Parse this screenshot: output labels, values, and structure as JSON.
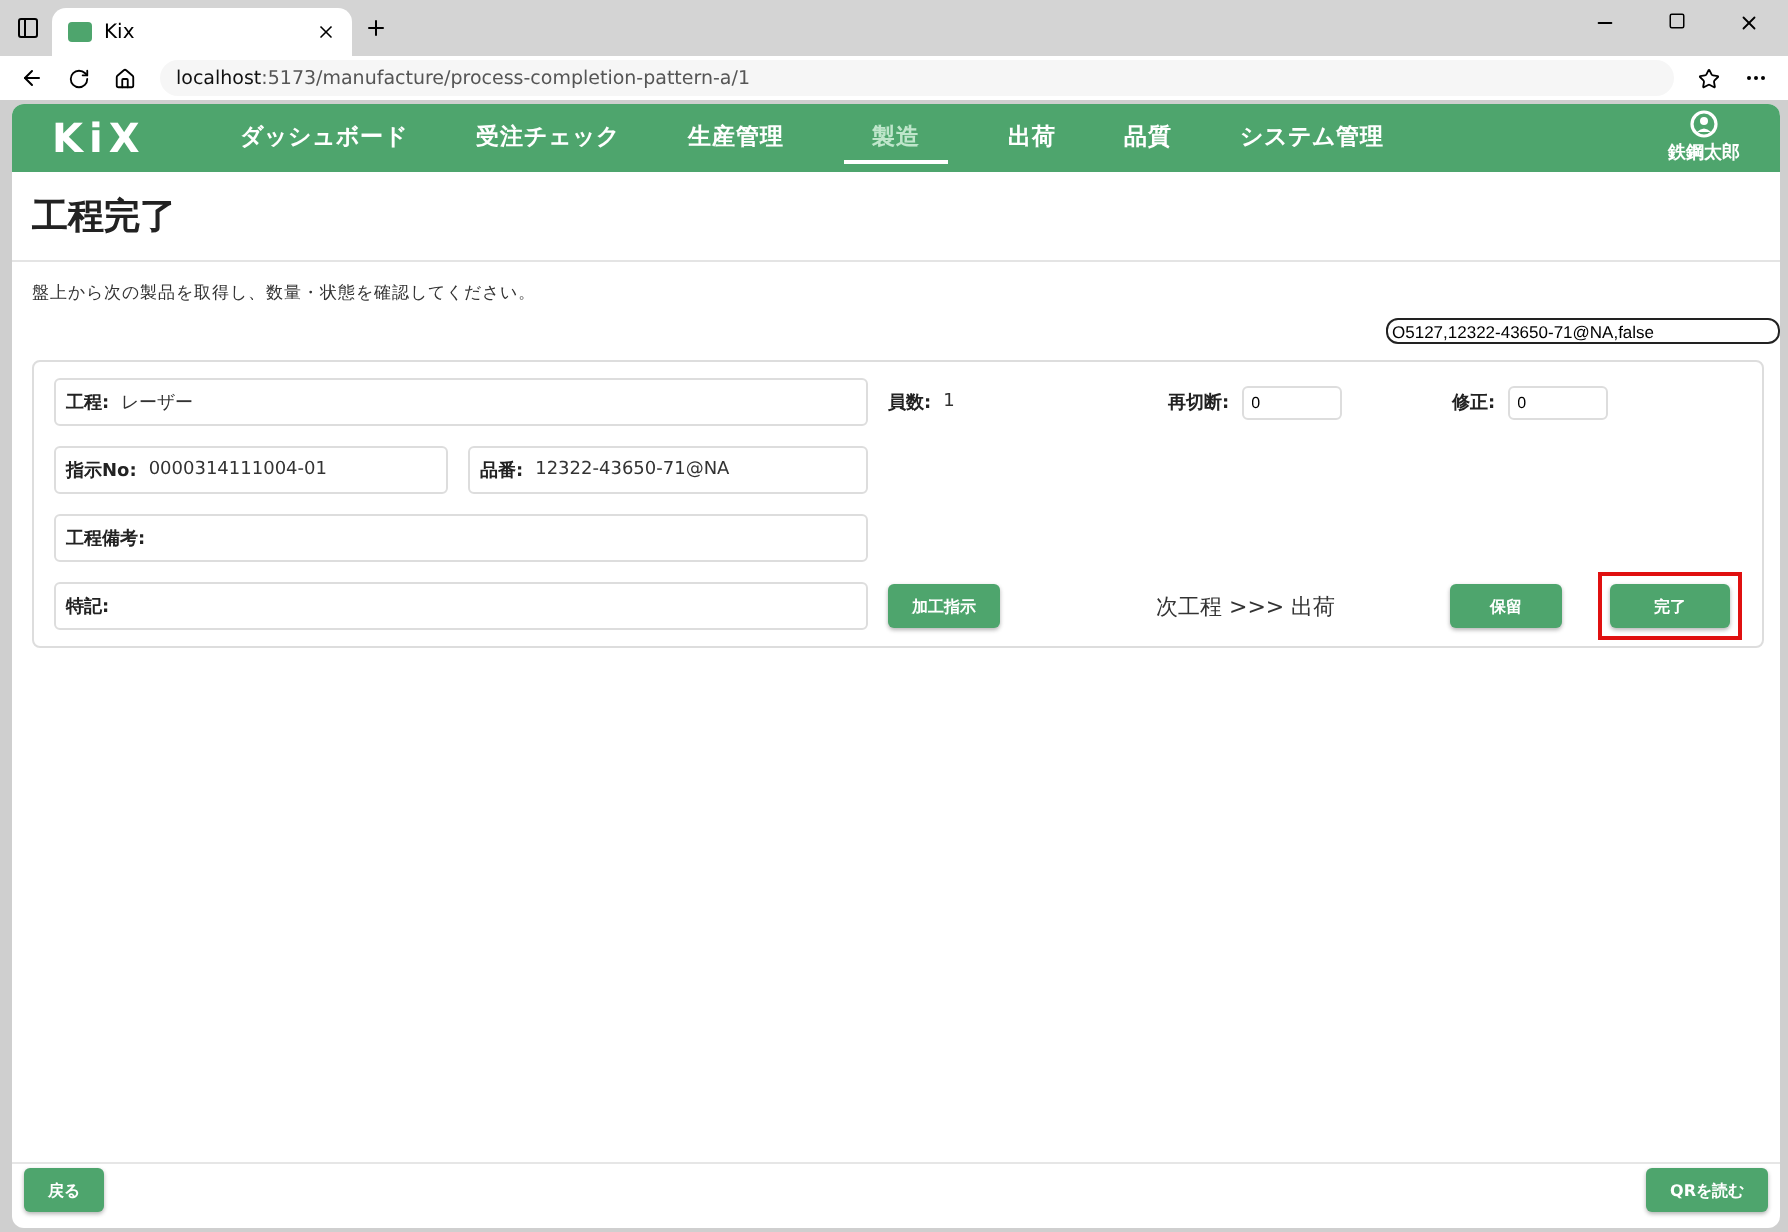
{
  "browser": {
    "tab_title": "Kix",
    "url_host": "localhost",
    "url_path": ":5173/manufacture/process-completion-pattern-a/1"
  },
  "header": {
    "logo": "KiX",
    "nav": [
      {
        "label": "ダッシュボード",
        "selected": false
      },
      {
        "label": "受注チェック",
        "selected": false
      },
      {
        "label": "生産管理",
        "selected": false
      },
      {
        "label": "製造",
        "selected": true
      },
      {
        "label": "出荷",
        "selected": false
      },
      {
        "label": "品質",
        "selected": false
      },
      {
        "label": "システム管理",
        "selected": false
      }
    ],
    "user": "鉄鋼太郎"
  },
  "page": {
    "title": "工程完了",
    "instruction": "盤上から次の製品を取得し、数量・状態を確認してください。",
    "qr_value": "O5127,12322-43650-71@NA,false"
  },
  "form": {
    "process": {
      "label": "工程:",
      "value": "レーザー"
    },
    "order_no": {
      "label": "指示No:",
      "value": "0000314111004-01"
    },
    "part_no": {
      "label": "品番:",
      "value": "12322-43650-71@NA"
    },
    "remarks": {
      "label": "工程備考:"
    },
    "notes": {
      "label": "特記:"
    },
    "staff": {
      "label": "員数:",
      "value": "1"
    },
    "recut": {
      "label": "再切断:",
      "value": "0"
    },
    "fix": {
      "label": "修正:",
      "value": "0"
    },
    "instruction_button": "加工指示",
    "next_process": "次工程 >>> 出荷",
    "hold_button": "保留",
    "complete_button": {
      "label": "完了",
      "highlighted": true
    }
  },
  "footer": {
    "back_button": "戻る",
    "qr_button": "QRを読む"
  }
}
